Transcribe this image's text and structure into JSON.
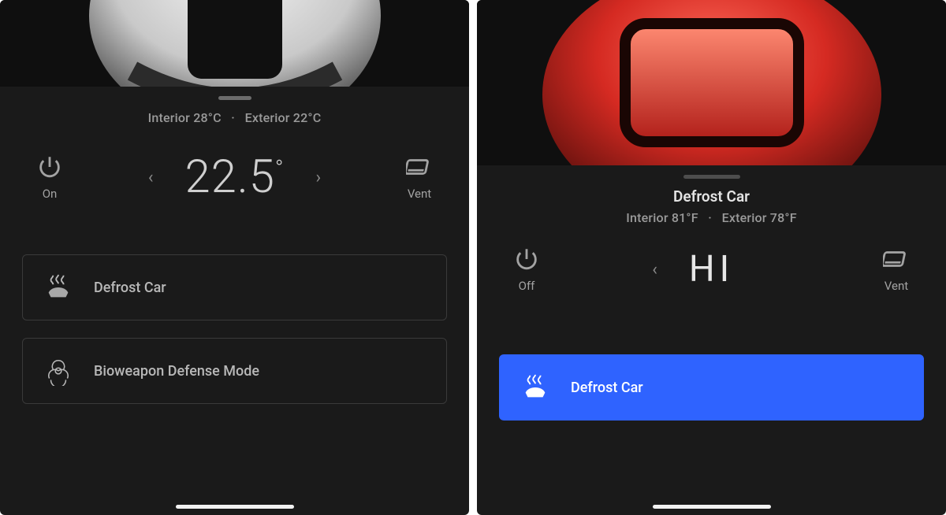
{
  "left": {
    "interior_label": "Interior 28°C",
    "separator": "·",
    "exterior_label": "Exterior 22°C",
    "power_label": "On",
    "temp_setpoint": "22.5",
    "degree_mark": "°",
    "vent_label": "Vent",
    "defrost_label": "Defrost Car",
    "bioweapon_label": "Bioweapon Defense Mode"
  },
  "right": {
    "title": "Defrost Car",
    "interior_label": "Interior 81°F",
    "separator": "·",
    "exterior_label": "Exterior 78°F",
    "power_label": "Off",
    "temp_setpoint": "HI",
    "vent_label": "Vent",
    "defrost_label": "Defrost Car"
  },
  "colors": {
    "accent": "#2f63ff"
  }
}
